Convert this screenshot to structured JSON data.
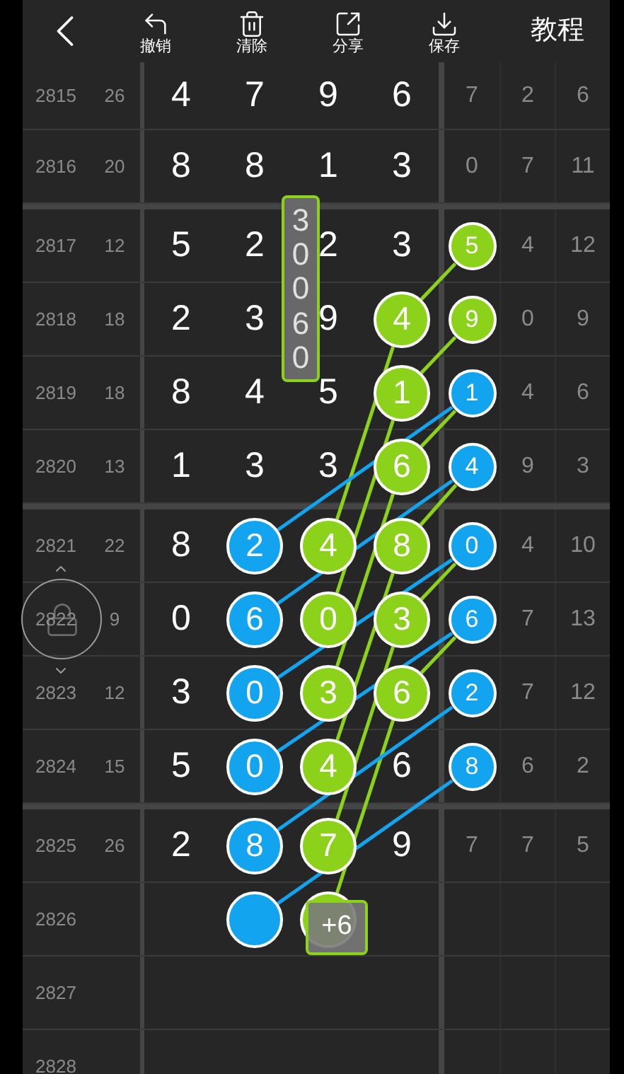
{
  "toolbar": {
    "actions": [
      {
        "kind": "undo",
        "label": "撤销"
      },
      {
        "kind": "clear",
        "label": "清除"
      },
      {
        "kind": "share",
        "label": "分享"
      },
      {
        "kind": "save",
        "label": "保存"
      }
    ],
    "tutorial": "教程"
  },
  "groups": [
    {
      "rows": [
        {
          "issue": "2815",
          "sum": "26",
          "cells": [
            {
              "kind": "number",
              "text": "4"
            },
            {
              "kind": "number",
              "text": "7"
            },
            {
              "kind": "number",
              "text": "9"
            },
            {
              "kind": "number",
              "text": "6"
            },
            {
              "kind": "number",
              "text": "7"
            },
            {
              "kind": "number",
              "text": "2"
            },
            {
              "kind": "number",
              "text": "6"
            }
          ]
        },
        {
          "issue": "2816",
          "sum": "20",
          "cells": [
            {
              "kind": "number",
              "text": "8"
            },
            {
              "kind": "number",
              "text": "8"
            },
            {
              "kind": "number",
              "text": "1"
            },
            {
              "kind": "number",
              "text": "3"
            },
            {
              "kind": "number",
              "text": "0"
            },
            {
              "kind": "number",
              "text": "7"
            },
            {
              "kind": "number",
              "text": "11"
            }
          ]
        }
      ]
    },
    {
      "rows": [
        {
          "issue": "2817",
          "sum": "12",
          "cells": [
            {
              "kind": "number",
              "text": "5"
            },
            {
              "kind": "number",
              "text": "2"
            },
            {
              "kind": "number",
              "text": "2"
            },
            {
              "kind": "number",
              "text": "3"
            },
            {
              "kind": "ball",
              "color": "#8cd21b",
              "text": "5"
            },
            {
              "kind": "number",
              "text": "4"
            },
            {
              "kind": "number",
              "text": "12"
            }
          ]
        },
        {
          "issue": "2818",
          "sum": "18",
          "cells": [
            {
              "kind": "number",
              "text": "2"
            },
            {
              "kind": "number",
              "text": "3"
            },
            {
              "kind": "number",
              "text": "9"
            },
            {
              "kind": "ball",
              "color": "#8cd21b",
              "text": "4"
            },
            {
              "kind": "ball",
              "color": "#8cd21b",
              "text": "9"
            },
            {
              "kind": "number",
              "text": "0"
            },
            {
              "kind": "number",
              "text": "9"
            }
          ]
        },
        {
          "issue": "2819",
          "sum": "18",
          "cells": [
            {
              "kind": "number",
              "text": "8"
            },
            {
              "kind": "number",
              "text": "4"
            },
            {
              "kind": "number",
              "text": "5"
            },
            {
              "kind": "ball",
              "color": "#8cd21b",
              "text": "1"
            },
            {
              "kind": "ball",
              "color": "#12a4ef",
              "text": "1"
            },
            {
              "kind": "number",
              "text": "4"
            },
            {
              "kind": "number",
              "text": "6"
            }
          ]
        },
        {
          "issue": "2820",
          "sum": "13",
          "cells": [
            {
              "kind": "number",
              "text": "1"
            },
            {
              "kind": "number",
              "text": "3"
            },
            {
              "kind": "number",
              "text": "3"
            },
            {
              "kind": "ball",
              "color": "#8cd21b",
              "text": "6"
            },
            {
              "kind": "ball",
              "color": "#12a4ef",
              "text": "4"
            },
            {
              "kind": "number",
              "text": "9"
            },
            {
              "kind": "number",
              "text": "3"
            }
          ]
        }
      ]
    },
    {
      "rows": [
        {
          "issue": "2821",
          "sum": "22",
          "cells": [
            {
              "kind": "number",
              "text": "8"
            },
            {
              "kind": "ball",
              "color": "#12a4ef",
              "text": "2"
            },
            {
              "kind": "ball",
              "color": "#8cd21b",
              "text": "4"
            },
            {
              "kind": "ball",
              "color": "#8cd21b",
              "text": "8"
            },
            {
              "kind": "ball",
              "color": "#12a4ef",
              "text": "0"
            },
            {
              "kind": "number",
              "text": "4"
            },
            {
              "kind": "number",
              "text": "10"
            }
          ]
        },
        {
          "issue": "2822",
          "sum": "9",
          "cells": [
            {
              "kind": "number",
              "text": "0"
            },
            {
              "kind": "ball",
              "color": "#12a4ef",
              "text": "6"
            },
            {
              "kind": "ball",
              "color": "#8cd21b",
              "text": "0"
            },
            {
              "kind": "ball",
              "color": "#8cd21b",
              "text": "3"
            },
            {
              "kind": "ball",
              "color": "#12a4ef",
              "text": "6"
            },
            {
              "kind": "number",
              "text": "7"
            },
            {
              "kind": "number",
              "text": "13"
            }
          ]
        },
        {
          "issue": "2823",
          "sum": "12",
          "cells": [
            {
              "kind": "number",
              "text": "3"
            },
            {
              "kind": "ball",
              "color": "#12a4ef",
              "text": "0"
            },
            {
              "kind": "ball",
              "color": "#8cd21b",
              "text": "3"
            },
            {
              "kind": "ball",
              "color": "#8cd21b",
              "text": "6"
            },
            {
              "kind": "ball",
              "color": "#12a4ef",
              "text": "2"
            },
            {
              "kind": "number",
              "text": "7"
            },
            {
              "kind": "number",
              "text": "12"
            }
          ]
        },
        {
          "issue": "2824",
          "sum": "15",
          "cells": [
            {
              "kind": "number",
              "text": "5"
            },
            {
              "kind": "ball",
              "color": "#12a4ef",
              "text": "0"
            },
            {
              "kind": "ball",
              "color": "#8cd21b",
              "text": "4"
            },
            {
              "kind": "number",
              "text": "6"
            },
            {
              "kind": "ball",
              "color": "#12a4ef",
              "text": "8"
            },
            {
              "kind": "number",
              "text": "6"
            },
            {
              "kind": "number",
              "text": "2"
            }
          ]
        }
      ]
    },
    {
      "rows": [
        {
          "issue": "2825",
          "sum": "26",
          "cells": [
            {
              "kind": "number",
              "text": "2"
            },
            {
              "kind": "ball",
              "color": "#12a4ef",
              "text": "8"
            },
            {
              "kind": "ball",
              "color": "#8cd21b",
              "text": "7"
            },
            {
              "kind": "number",
              "text": "9"
            },
            {
              "kind": "number",
              "text": "7"
            },
            {
              "kind": "number",
              "text": "7"
            },
            {
              "kind": "number",
              "text": "5"
            }
          ]
        },
        {
          "issue": "2826",
          "cells": [
            {
              "kind": "empty"
            },
            {
              "kind": "ball",
              "color": "#12a4ef"
            },
            {
              "kind": "ball",
              "color": "#8cd21b"
            },
            {
              "kind": "empty"
            },
            {
              "kind": "empty"
            },
            {
              "kind": "empty"
            },
            {
              "kind": "empty"
            }
          ]
        },
        {
          "issue": "2827"
        },
        {
          "issue": "2828"
        }
      ]
    }
  ],
  "candidate": "30060",
  "badge": "+6"
}
